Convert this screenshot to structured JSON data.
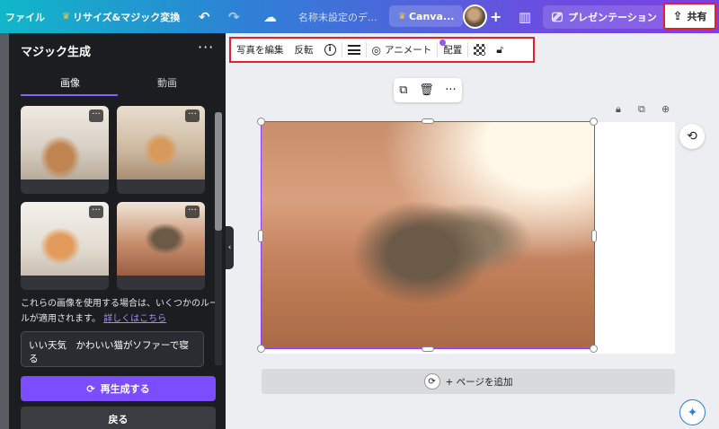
{
  "topbar": {
    "file_label": "ファイル",
    "resize_label": "リサイズ&マジック変換",
    "undo_icon": "undo-icon",
    "redo_icon": "redo-icon",
    "cloud_icon": "cloud-saved-icon",
    "doc_title": "名称未設定のデ...",
    "canva_label": "Canva...",
    "add_label": "+",
    "present_label": "プレゼンテーション",
    "share_label": "共有"
  },
  "panel": {
    "title": "マジック生成",
    "more": "···",
    "tabs": [
      {
        "label": "画像"
      },
      {
        "label": "動画"
      }
    ],
    "note_text": "これらの画像を使用する場合は、いくつかのルールが適用されます。",
    "note_link": "詳しくはこちら",
    "prompt_value": "いい天気　かわいい猫がソファーで寝る",
    "regenerate_label": "再生成する",
    "back_label": "戻る"
  },
  "context_toolbar": {
    "edit_photo": "写真を編集",
    "flip": "反転",
    "animate": "アニメート",
    "position": "配置"
  },
  "canvas": {
    "add_page_label": "+ ページを追加"
  },
  "colors": {
    "accent": "#8b3dff",
    "highlight": "#e5202e",
    "panel_bg": "#1c1d21"
  }
}
